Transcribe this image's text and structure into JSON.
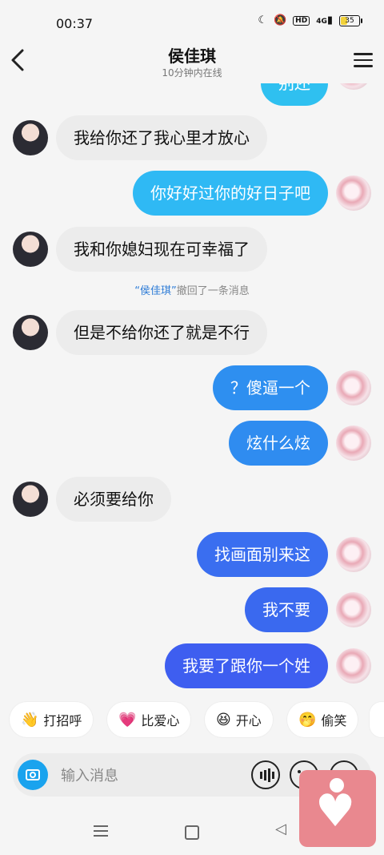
{
  "status_bar": {
    "time": "00:37",
    "icons": [
      "moon-icon",
      "bell-off-icon",
      "hd-icon",
      "signal-4g-icon",
      "battery-icon"
    ],
    "hd_label": "HD",
    "network": "4G",
    "battery": "35"
  },
  "header": {
    "title": "侯佳琪",
    "subtitle": "10分钟内在线"
  },
  "messages": [
    {
      "side": "out",
      "text": "别还",
      "color": "#2fc0f0"
    },
    {
      "side": "in",
      "text": "我给你还了我心里才放心"
    },
    {
      "side": "out",
      "text": "你好好过你的好日子吧",
      "color": "#2fb9f4"
    },
    {
      "side": "in",
      "text": "我和你媳妇现在可幸福了"
    },
    {
      "side": "in",
      "text": "但是不给你还了就是不行"
    },
    {
      "side": "out",
      "text": "？傻逼一个",
      "color": "#2e8ff0"
    },
    {
      "side": "out",
      "text": "炫什么炫",
      "color": "#2f8cf0"
    },
    {
      "side": "in",
      "text": "必须要给你"
    },
    {
      "side": "out",
      "text": "找画面别来这",
      "color": "#3a6ef0"
    },
    {
      "side": "out",
      "text": "我不要",
      "color": "#3a69ef"
    },
    {
      "side": "out",
      "text": "我要了跟你一个姓",
      "color": "#3e5ef0"
    }
  ],
  "recall_notice": {
    "name": "“侯佳琪”",
    "text": "撤回了一条消息"
  },
  "quick_replies": [
    {
      "icon": "wave-hand-icon",
      "emoji": "👋",
      "label": "打招呼"
    },
    {
      "icon": "heart-icon",
      "emoji": "💗",
      "label": "比爱心"
    },
    {
      "icon": "grin-icon",
      "emoji": "😆",
      "label": "开心"
    },
    {
      "icon": "smirk-icon",
      "emoji": "🤭",
      "label": "偷笑"
    }
  ],
  "input": {
    "placeholder": "输入消息"
  },
  "colors": {
    "incoming_bubble": "#ececec",
    "camera_button": "#1aa3ee",
    "floating_app": "#e9888f"
  }
}
